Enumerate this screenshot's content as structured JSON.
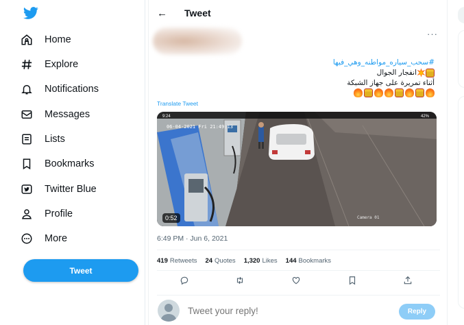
{
  "sidebar": {
    "logo": "twitter-bird-icon",
    "items": [
      {
        "label": "Home",
        "icon": "home-icon"
      },
      {
        "label": "Explore",
        "icon": "hashtag-icon"
      },
      {
        "label": "Notifications",
        "icon": "bell-icon"
      },
      {
        "label": "Messages",
        "icon": "envelope-icon"
      },
      {
        "label": "Lists",
        "icon": "list-icon"
      },
      {
        "label": "Bookmarks",
        "icon": "bookmark-icon"
      },
      {
        "label": "Twitter Blue",
        "icon": "twitter-blue-icon"
      },
      {
        "label": "Profile",
        "icon": "person-icon"
      },
      {
        "label": "More",
        "icon": "more-circle-icon"
      }
    ],
    "tweet_button": "Tweet"
  },
  "header": {
    "back_icon": "←",
    "title": "Tweet"
  },
  "tweet": {
    "more": "···",
    "hashtag": "#سحب_سياره_مواطنه_وهي_فيها",
    "line1": "انفجار الجوال",
    "line2": "أثناء تمريرة على جهاز الشبكة",
    "translate": "Translate Tweet",
    "video": {
      "duration": "0:52",
      "overlay_time": "9:24",
      "overlay_date": "06-04-2021 Fri 21:49:13",
      "camera_label": "Camera 01",
      "status": "42%"
    },
    "timestamp": "6:49 PM · Jun 6, 2021",
    "stats": [
      {
        "count": "419",
        "label": "Retweets"
      },
      {
        "count": "24",
        "label": "Quotes"
      },
      {
        "count": "1,320",
        "label": "Likes"
      },
      {
        "count": "144",
        "label": "Bookmarks"
      }
    ],
    "actions": [
      "reply-icon",
      "retweet-icon",
      "like-icon",
      "bookmark-icon",
      "share-icon"
    ]
  },
  "reply": {
    "placeholder": "Tweet your reply!",
    "button": "Reply"
  },
  "colors": {
    "accent": "#1d9bf0",
    "reply_button_disabled": "#8ecdf7",
    "text_secondary": "#536471"
  }
}
